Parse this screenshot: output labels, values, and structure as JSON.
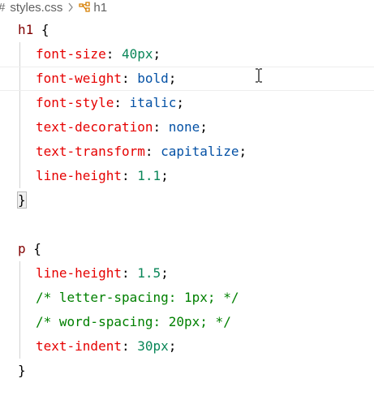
{
  "breadcrumb": {
    "hash": "#",
    "file": "styles.css",
    "symbol": "h1"
  },
  "icons": {
    "chevron": "chevron-right-icon",
    "symbol": "symbol-class-icon",
    "cursor": "text-cursor-icon"
  },
  "code": {
    "h1_rule": {
      "selector": "h1",
      "open": "{",
      "close": "}",
      "declarations": [
        {
          "prop": "font-size",
          "value": "40px"
        },
        {
          "prop": "font-weight",
          "value": "bold"
        },
        {
          "prop": "font-style",
          "value": "italic"
        },
        {
          "prop": "text-decoration",
          "value": "none"
        },
        {
          "prop": "text-transform",
          "value": "capitalize"
        },
        {
          "prop": "line-height",
          "value": "1.1"
        }
      ]
    },
    "p_rule": {
      "selector": "p",
      "open": "{",
      "close": "}",
      "line1": {
        "prop": "line-height",
        "value": "1.5"
      },
      "comment1": "/* letter-spacing: 1px; */",
      "comment2": "/* word-spacing: 20px; */",
      "line4": {
        "prop": "text-indent",
        "value": "30px"
      }
    }
  },
  "colors": {
    "selector": "#800000",
    "property": "#e50000",
    "number": "#098658",
    "keyword": "#0451a5",
    "comment": "#008000"
  }
}
